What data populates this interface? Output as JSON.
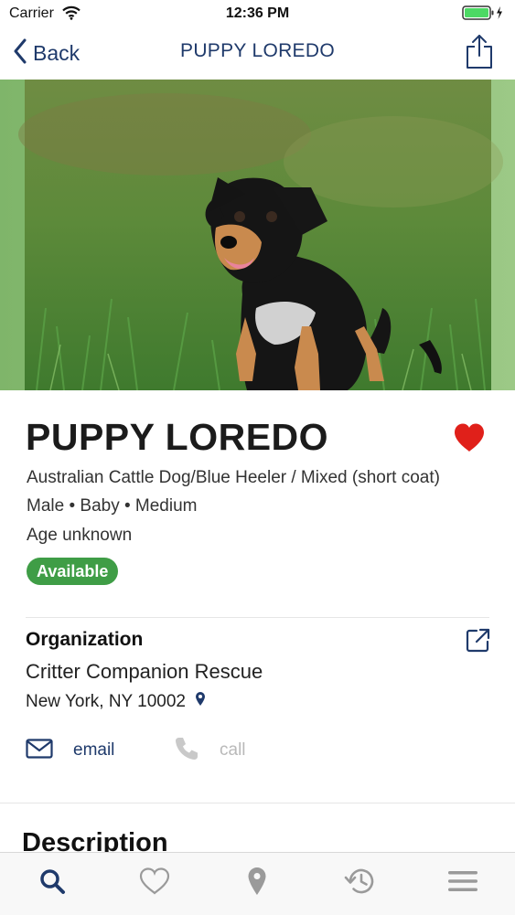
{
  "status_bar": {
    "carrier": "Carrier",
    "time": "12:36 PM"
  },
  "nav": {
    "back_label": "Back",
    "title": "PUPPY LOREDO",
    "share_icon": "share-icon"
  },
  "pet": {
    "name": "PUPPY LOREDO",
    "breed": "Australian Cattle Dog/Blue Heeler / Mixed (short coat)",
    "attributes": "Male • Baby • Medium",
    "age": "Age unknown",
    "status": "Available",
    "is_favorite": true
  },
  "organization": {
    "heading": "Organization",
    "name": "Critter Companion Rescue",
    "location": "New York, NY 10002"
  },
  "contact": {
    "email_label": "email",
    "call_label": "call"
  },
  "description": {
    "heading": "Description"
  },
  "tabbar": {
    "items": [
      "search-icon",
      "heart-icon",
      "location-pin-icon",
      "history-icon",
      "menu-icon"
    ],
    "active": "search-icon"
  },
  "colors": {
    "navy": "#1f3a6b",
    "favorite": "#e0201a",
    "available": "#3f9d46",
    "disabled": "#b9b9b9"
  }
}
